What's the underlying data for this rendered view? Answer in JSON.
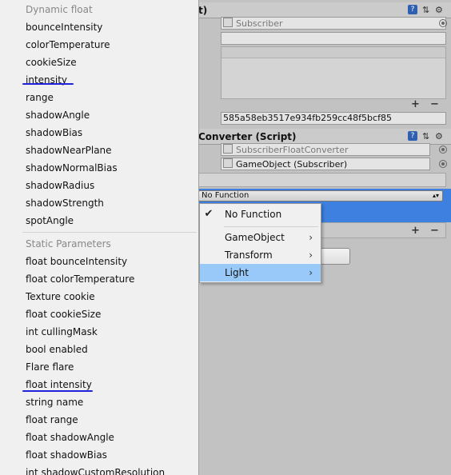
{
  "inspector": {
    "event_component": {
      "title": "t)",
      "target_value": "Subscriber",
      "guid": "585a58eb3517e934fb259cc48f5bcf85"
    },
    "converter_component": {
      "title": "Converter (Script)",
      "script_value": "SubscriberFloatConverter",
      "object_value": "GameObject (Subscriber)",
      "function_value": "No Function"
    },
    "list_controls": {
      "plus": "+",
      "minus": "−"
    }
  },
  "left_menu": {
    "sections": [
      {
        "header": "Dynamic float",
        "items": [
          "bounceIntensity",
          "colorTemperature",
          "cookieSize",
          "intensity",
          "range",
          "shadowAngle",
          "shadowBias",
          "shadowNearPlane",
          "shadowNormalBias",
          "shadowRadius",
          "shadowStrength",
          "spotAngle"
        ]
      },
      {
        "header": "Static Parameters",
        "items": [
          "float bounceIntensity",
          "float colorTemperature",
          "Texture cookie",
          "float cookieSize",
          "int cullingMask",
          "bool enabled",
          "Flare flare",
          "float intensity",
          "string name",
          "float range",
          "float shadowAngle",
          "float shadowBias",
          "int shadowCustomResolution"
        ]
      }
    ],
    "underlined_items": [
      "intensity",
      "float intensity"
    ],
    "underline_color": "#2222dd"
  },
  "sub_menu": {
    "items": [
      {
        "label": "No Function",
        "checked": true,
        "submenu": false
      },
      {
        "label": "GameObject",
        "checked": false,
        "submenu": true
      },
      {
        "label": "Transform",
        "checked": false,
        "submenu": true
      },
      {
        "label": "Light",
        "checked": false,
        "submenu": true,
        "highlighted": true
      }
    ],
    "highlight_color": "#99c9f8"
  }
}
